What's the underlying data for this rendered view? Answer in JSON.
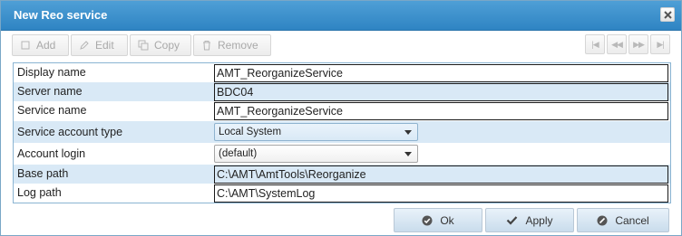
{
  "dialog": {
    "title": "New Reo service"
  },
  "toolbar": {
    "add": "Add",
    "edit": "Edit",
    "copy": "Copy",
    "remove": "Remove"
  },
  "nav": {
    "first": "|◀",
    "prev": "◀◀",
    "next": "▶▶",
    "last": "▶|"
  },
  "fields": {
    "display_name": {
      "label": "Display name",
      "value": "AMT_ReorganizeService"
    },
    "server_name": {
      "label": "Server name",
      "value": "BDC04"
    },
    "service_name": {
      "label": "Service name",
      "value": "AMT_ReorganizeService"
    },
    "service_account_type": {
      "label": "Service account type",
      "value": "Local System"
    },
    "account_login": {
      "label": "Account login",
      "value": "(default)"
    },
    "base_path": {
      "label": "Base path",
      "value": "C:\\AMT\\AmtTools\\Reorganize"
    },
    "log_path": {
      "label": "Log path",
      "value": "C:\\AMT\\SystemLog"
    }
  },
  "footer": {
    "ok": "Ok",
    "apply": "Apply",
    "cancel": "Cancel"
  }
}
